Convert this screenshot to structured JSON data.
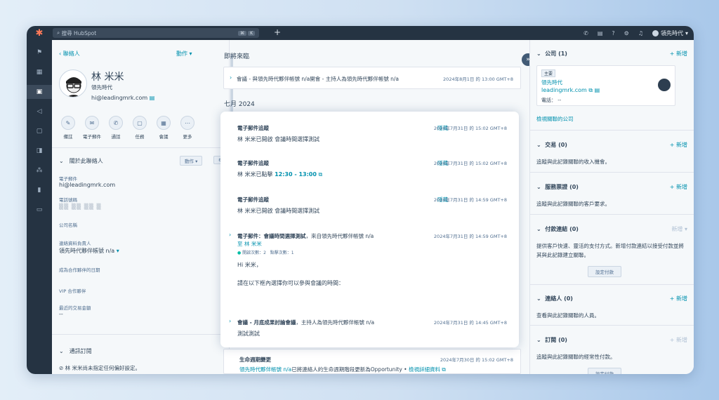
{
  "topbar": {
    "search_placeholder": "搜尋 HubSpot",
    "kbd1": "⌘",
    "kbd2": "K",
    "account": "領先時代"
  },
  "contact": {
    "back": "聯絡人",
    "actions": "動作",
    "name": "林 米米",
    "company": "領先時代",
    "email": "hi@leadingmrk.com"
  },
  "quick_actions": [
    "備註",
    "電子郵件",
    "通話",
    "任務",
    "會議",
    "更多"
  ],
  "about": {
    "title": "關於此聯絡人",
    "actions": "動作",
    "email_label": "電子郵件",
    "email_value": "hi@leadingmrk.com",
    "phone_label": "電話號碼",
    "company_label": "公司名稱",
    "owner_label": "連絡資料負責人",
    "owner_value": "領先時代夥伴帳號 n/a",
    "partner_date_label": "成為合作夥伴的日期",
    "vip_label": "VIP 合作夥伴",
    "recent_deal_label": "最近的交易金額",
    "recent_deal_value": "--"
  },
  "subscriptions": {
    "title": "通訊訂閱",
    "text": "林 米米尚未指定任何偏好設定。"
  },
  "timeline": {
    "upcoming_title": "即將來臨",
    "upcoming_text": "會議 - 與領先時代夥伴帳號 n/a開會 - 主持人為領先時代夥伴帳號 n/a",
    "upcoming_time": "2024年8月1日 的 13:00 GMT+8",
    "month": "七月 2024",
    "items": [
      {
        "title": "電子郵件追蹤",
        "body": "林 米米已開啟 會議時間選擇測試",
        "hide": "隱藏",
        "time": "2024年7月31日 的 15:02 GMT+8"
      },
      {
        "title": "電子郵件追蹤",
        "body_prefix": "林 米米已點擊",
        "body_link": "12:30 - 13:00",
        "hide": "隱藏",
        "time": "2024年7月31日 的 15:02 GMT+8"
      },
      {
        "title": "電子郵件追蹤",
        "body": "林 米米已開啟 會議時間選擇測試",
        "hide": "隱藏",
        "time": "2024年7月31日 的 14:59 GMT+8"
      }
    ],
    "email": {
      "title": "電子郵件：會議時間選擇測試",
      "from": "，來自領先時代夥伴帳號 n/a",
      "to": "至 林 米米",
      "opens": "開啟次數：2",
      "clicks": "點擊次數：1",
      "greeting": "Hi 米米，",
      "body": "請在以下框內選擇你可以參與會議的時間：",
      "time": "2024年7月31日 的 14:59 GMT+8"
    },
    "meeting": {
      "title": "會議 - 月底成果討論會議",
      "host": "，主持人為領先時代夥伴帳號 n/a",
      "body": "測試測試",
      "time": "2024年7月31日 的 14:45 GMT+8"
    },
    "lifecycle": {
      "title": "生命週期變更",
      "text_link": "領先時代夥伴帳號 n/a",
      "text": "已將連絡人的生命週期階段更新為Opportunity",
      "detail_link": "檢視詳細資料",
      "time": "2024年7月30日 的 15:02 GMT+8"
    }
  },
  "right": {
    "company": {
      "title": "公司 (1)",
      "add": "+ 新增",
      "primary": "主要",
      "name": "領先時代",
      "domain": "leadingmrk.com",
      "phone": "電話： --",
      "view": "檢視關聯的公司"
    },
    "deals": {
      "title": "交易 (0)",
      "add": "+ 新增",
      "text": "追蹤與此記錄關聯的收入機會。"
    },
    "tickets": {
      "title": "服務票證 (0)",
      "add": "+ 新增",
      "text": "追蹤與此記錄關聯的客戶要求。"
    },
    "payments": {
      "title": "付款連結 (0)",
      "add": "新增",
      "text": "提供客戶快速、靈活的支付方式。新增付款連結以接受付款並將其與此記錄建立關聯。",
      "button": "設定付款"
    },
    "contacts": {
      "title": "連絡人 (0)",
      "add": "+ 新增",
      "text": "查看與此記錄關聯的人員。"
    },
    "orders": {
      "title": "訂閱 (0)",
      "add": "+ 新增",
      "text": "追蹤與此記錄關聯的經常性付款。",
      "button": "設定付款"
    }
  }
}
